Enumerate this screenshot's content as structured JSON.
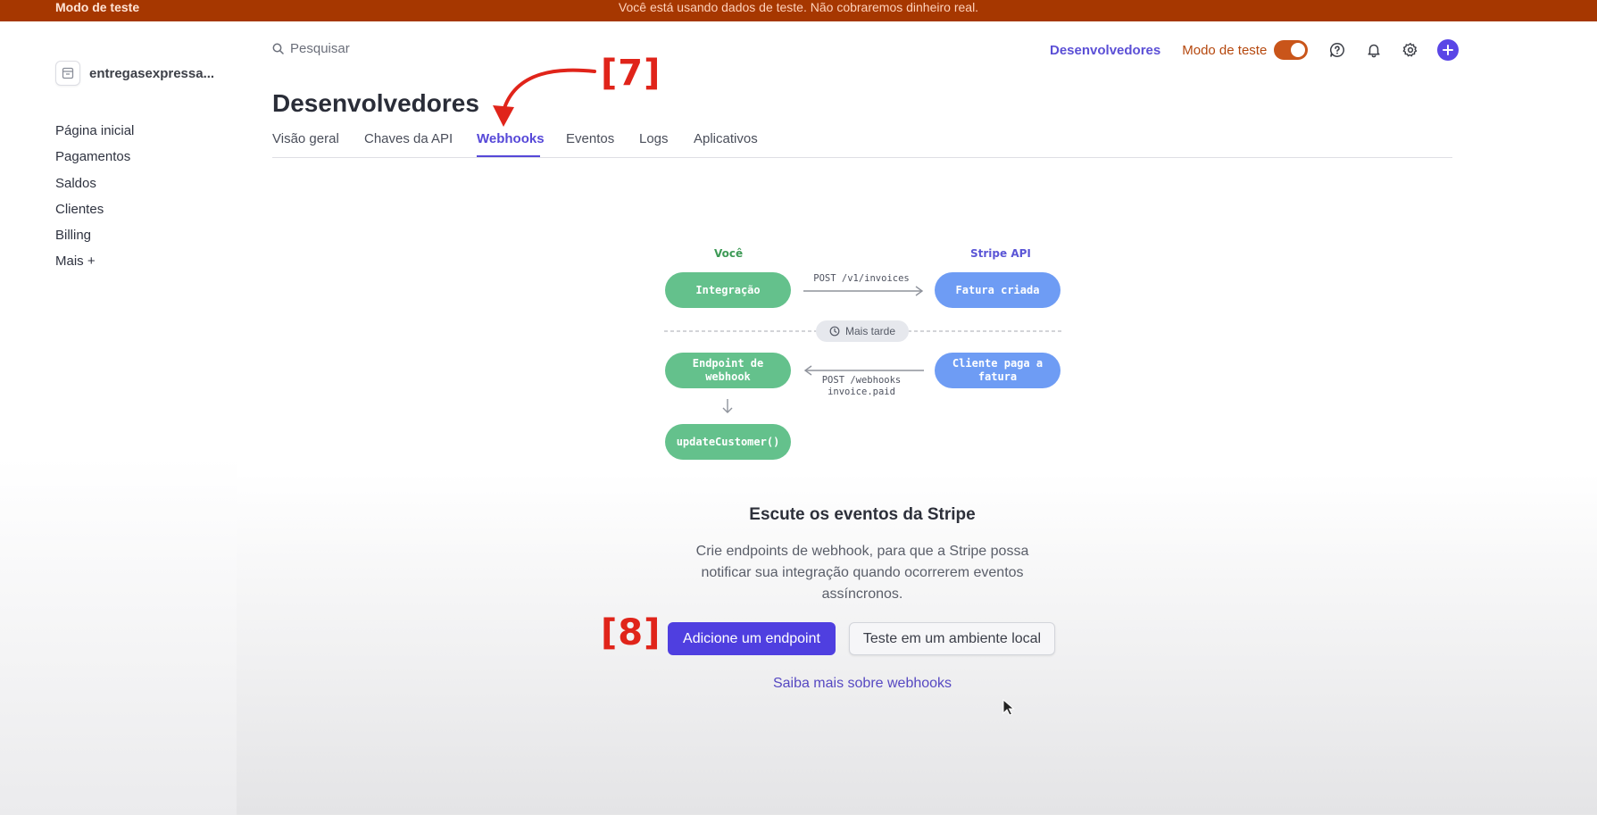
{
  "banner": {
    "left": "Modo de teste",
    "center": "Você está usando dados de teste. Não cobraremos dinheiro real."
  },
  "account": {
    "name": "entregasexpressa..."
  },
  "sidebar": {
    "items": [
      {
        "label": "Página inicial"
      },
      {
        "label": "Pagamentos"
      },
      {
        "label": "Saldos"
      },
      {
        "label": "Clientes"
      },
      {
        "label": "Billing"
      },
      {
        "label": "Mais +"
      }
    ]
  },
  "search": {
    "placeholder": "Pesquisar"
  },
  "header": {
    "developers_link": "Desenvolvedores",
    "test_mode_label": "Modo de teste",
    "test_mode_on": true,
    "icons": [
      "help-icon",
      "bell-icon",
      "gear-icon",
      "plus-icon"
    ]
  },
  "page": {
    "title": "Desenvolvedores"
  },
  "tabs": [
    {
      "label": "Visão geral"
    },
    {
      "label": "Chaves da API"
    },
    {
      "label": "Webhooks",
      "active": true
    },
    {
      "label": "Eventos"
    },
    {
      "label": "Logs"
    },
    {
      "label": "Aplicativos"
    }
  ],
  "annotations": {
    "a7": "[7]",
    "a8": "[8]"
  },
  "diagram": {
    "you_label": "Você",
    "stripe_label": "Stripe API",
    "integration": "Integração",
    "post_invoices": "POST /v1/invoices",
    "invoice_created": "Fatura criada",
    "later": "Mais tarde",
    "endpoint_line1": "Endpoint de",
    "endpoint_line2": "webhook",
    "customer_pays_line1": "Cliente paga a",
    "customer_pays_line2": "fatura",
    "post_webhooks_line1": "POST /webhooks",
    "post_webhooks_line2": "invoice.paid",
    "update_customer": "updateCustomer()"
  },
  "empty_state": {
    "title": "Escute os eventos da Stripe",
    "description": "Crie endpoints de webhook, para que a Stripe possa notificar sua integração quando ocorrerem eventos assíncronos.",
    "primary_button": "Adicione um endpoint",
    "secondary_button": "Teste em um ambiente local",
    "learn_more": "Saiba mais sobre webhooks"
  },
  "colors": {
    "banner": "#a63700",
    "accent": "#5648d8",
    "toggle": "#c9551a",
    "green_pill": "#64c18c",
    "blue_pill": "#6e9cf4",
    "annotation": "#e0241a"
  }
}
